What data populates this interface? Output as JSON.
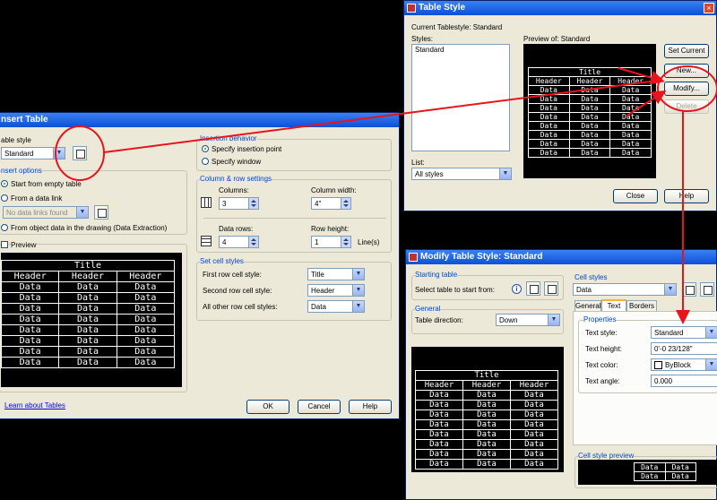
{
  "insert_table": {
    "title": "nsert Table",
    "table_style_label": "able style",
    "table_style_value": "Standard",
    "insert_options_label": "nsert options",
    "opt_empty": "Start from empty table",
    "opt_data_link": "From a data link",
    "data_link_value": "No data links found",
    "opt_object_data": "From object data in the drawing (Data Extraction)",
    "preview_label": "Preview",
    "insertion_behavior_label": "Insertion behavior",
    "opt_insertion_point": "Specify insertion point",
    "opt_window": "Specify window",
    "col_row_label": "Column & row settings",
    "columns_label": "Columns:",
    "columns_value": "3",
    "col_width_label": "Column width:",
    "col_width_value": "4\"",
    "data_rows_label": "Data rows:",
    "data_rows_value": "4",
    "row_height_label": "Row height:",
    "row_height_value": "1",
    "row_height_unit": "Line(s)",
    "cell_styles_label": "Set cell styles",
    "first_row_label": "First row cell style:",
    "first_row_value": "Title",
    "second_row_label": "Second row cell style:",
    "second_row_value": "Header",
    "other_rows_label": "All other row cell styles:",
    "other_rows_value": "Data",
    "learn_link": "Learn about Tables",
    "ok": "OK",
    "cancel": "Cancel",
    "help": "Help"
  },
  "table_style": {
    "title": "Table Style",
    "current_label": "Current Tablestyle: Standard",
    "styles_label": "Styles:",
    "styles_item": "Standard",
    "preview_label": "Preview of: Standard",
    "list_label": "List:",
    "list_value": "All styles",
    "set_current": "Set Current",
    "new": "New...",
    "modify": "Modify...",
    "delete": "Delete",
    "close": "Close",
    "help": "Help"
  },
  "modify_style": {
    "title": "Modify Table Style: Standard",
    "starting_table_label": "Starting table",
    "select_table_label": "Select table to start from:",
    "general_label": "General",
    "direction_label": "Table direction:",
    "direction_value": "Down",
    "cell_styles_label": "Cell styles",
    "cell_style_value": "Data",
    "tabs": [
      "General",
      "Text",
      "Borders"
    ],
    "properties_label": "Properties",
    "text_style_label": "Text style:",
    "text_style_value": "Standard",
    "text_height_label": "Text height:",
    "text_height_value": "0'-0 23/128\"",
    "text_color_label": "Text color:",
    "text_color_value": "ByBlock",
    "text_angle_label": "Text angle:",
    "text_angle_value": "0.000",
    "cell_preview_label": "Cell style preview"
  },
  "preview_table": {
    "title": "Title",
    "header": "Header",
    "data": "Data"
  },
  "annotation_color": "#e8141c"
}
